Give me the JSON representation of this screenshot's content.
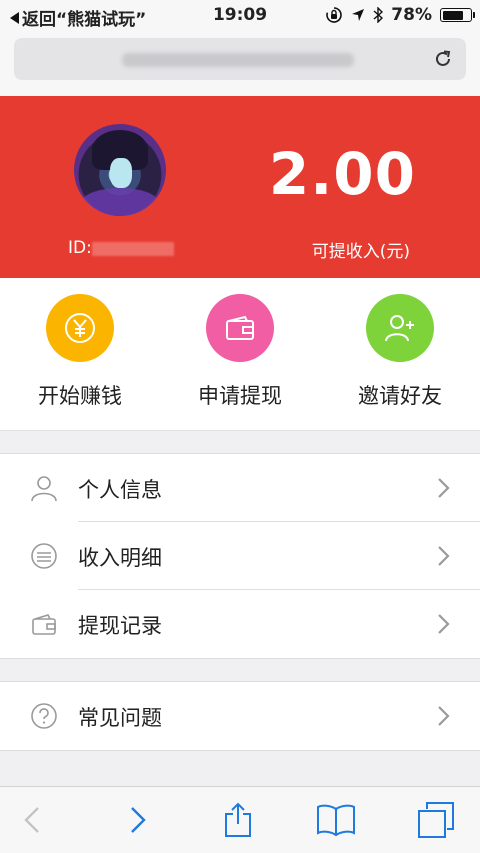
{
  "status_bar": {
    "back_app": "返回“熊猫试玩”",
    "time": "19:09",
    "battery_pct": "78%",
    "battery_level": 0.78
  },
  "header": {
    "id_label": "ID:",
    "balance": "2.00",
    "balance_label": "可提收入(元)",
    "bg_color": "#e63b30"
  },
  "actions": [
    {
      "label": "开始赚钱",
      "icon": "yuan-coin-icon",
      "color": "#fbb400"
    },
    {
      "label": "申请提现",
      "icon": "wallet-icon",
      "color": "#f25ea3"
    },
    {
      "label": "邀请好友",
      "icon": "add-user-icon",
      "color": "#7ed23a"
    }
  ],
  "menu_group_1": [
    {
      "label": "个人信息",
      "icon": "user-icon"
    },
    {
      "label": "收入明细",
      "icon": "list-circle-icon"
    },
    {
      "label": "提现记录",
      "icon": "wallet-outline-icon"
    }
  ],
  "menu_group_2": [
    {
      "label": "常见问题",
      "icon": "question-circle-icon"
    }
  ],
  "toolbar": {
    "accent": "#1f7ae0",
    "items": [
      "back-icon",
      "forward-icon",
      "share-icon",
      "bookmarks-icon",
      "tabs-icon"
    ]
  }
}
